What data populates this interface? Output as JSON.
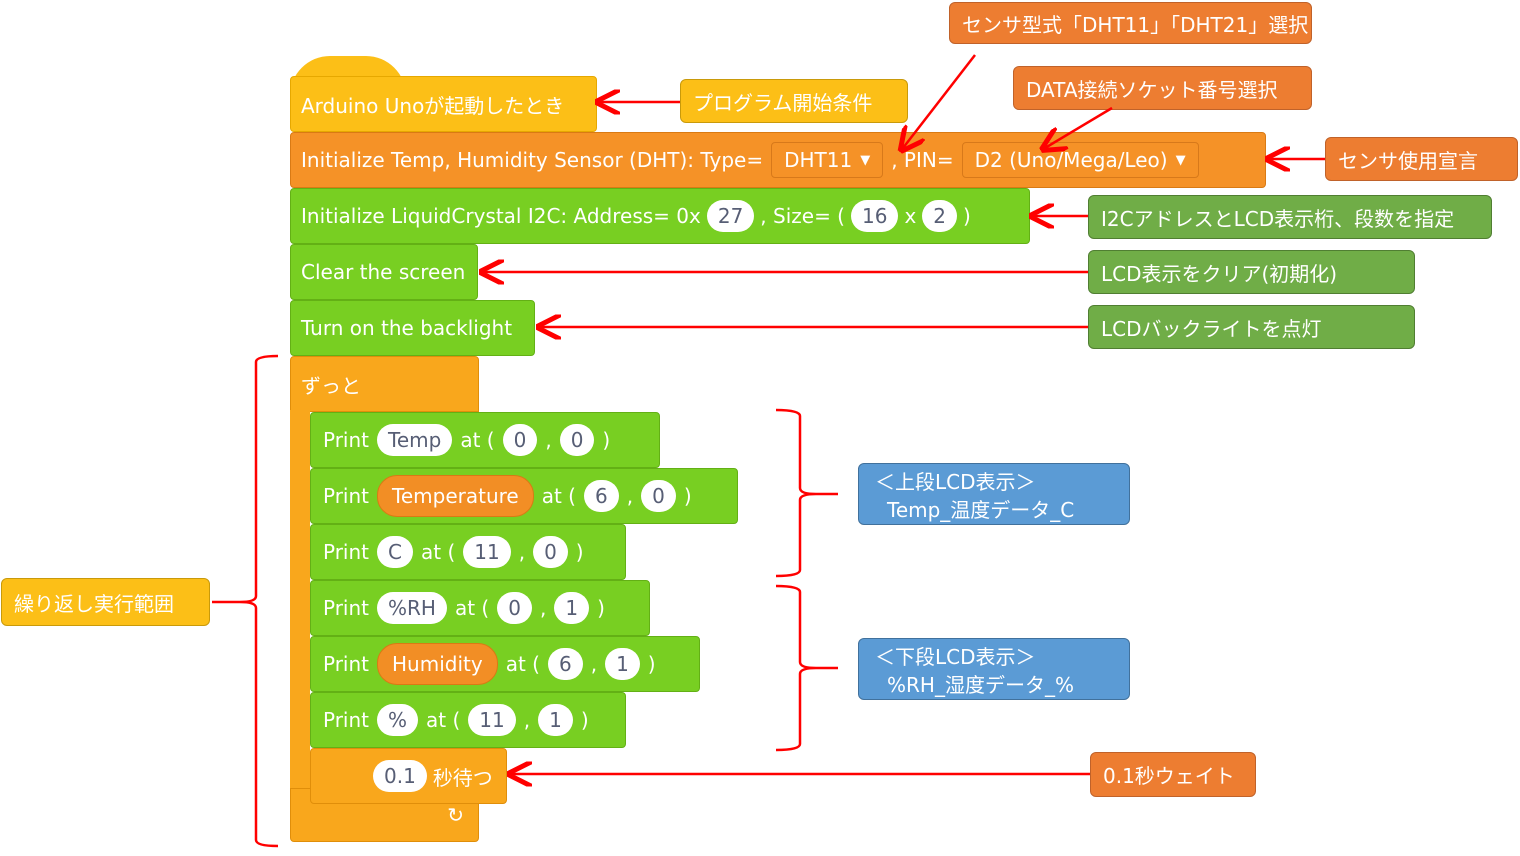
{
  "blocks": {
    "start": {
      "label": "Arduino Unoが起動したとき"
    },
    "dht_init": {
      "label": "Initialize Temp, Humidity Sensor (DHT): Type=",
      "type_value": "DHT11",
      "pin_label": ", PIN=",
      "pin_value": "D2 (Uno/Mega/Leo)",
      "dropdown_arrow": "▼"
    },
    "lcd_init": {
      "label": "Initialize LiquidCrystal I2C: Address= 0x",
      "address": "27",
      "size_label": ", Size= (",
      "cols": "16",
      "x": "x",
      "rows": "2",
      "close": ")"
    },
    "clear": {
      "label": "Clear the screen"
    },
    "backlight": {
      "label": "Turn on the backlight"
    },
    "forever": {
      "label": "ずっと",
      "repeat_icon": "↻"
    },
    "prints": [
      {
        "print": "Print",
        "text": "Temp",
        "is_var": false,
        "at": "at (",
        "col": "0",
        "comma": ",",
        "row": "0",
        "close": ")"
      },
      {
        "print": "Print",
        "text": "Temperature",
        "is_var": true,
        "at": "at (",
        "col": "6",
        "comma": ",",
        "row": "0",
        "close": ")"
      },
      {
        "print": "Print",
        "text": "C",
        "is_var": false,
        "at": "at (",
        "col": "11",
        "comma": ",",
        "row": "0",
        "close": ")"
      },
      {
        "print": "Print",
        "text": "%RH",
        "is_var": false,
        "at": "at (",
        "col": "0",
        "comma": ",",
        "row": "1",
        "close": ")"
      },
      {
        "print": "Print",
        "text": "Humidity",
        "is_var": true,
        "at": "at (",
        "col": "6",
        "comma": ",",
        "row": "1",
        "close": ")"
      },
      {
        "print": "Print",
        "text": "%",
        "is_var": false,
        "at": "at (",
        "col": "11",
        "comma": ",",
        "row": "1",
        "close": ")"
      }
    ],
    "wait": {
      "value": "0.1",
      "label": "秒待つ"
    }
  },
  "callouts": {
    "program_start": "プログラム開始条件",
    "sensor_type": "センサ型式「DHT11」「DHT21」選択",
    "data_socket": "DATA接続ソケット番号選択",
    "sensor_decl": "センサ使用宣言",
    "i2c": "I2CアドレスとLCD表示桁、段数を指定",
    "clear": "LCD表示をクリア(初期化)",
    "backlight": "LCDバックライトを点灯",
    "upper_line1": "＜上段LCD表示＞",
    "upper_line2": "Temp_温度データ_C",
    "lower_line1": "＜下段LCD表示＞",
    "lower_line2": "%RH_湿度データ_%",
    "loop_range": "繰り返し実行範囲",
    "wait": "0.1秒ウェイト"
  },
  "colors": {
    "hat": "#fcbf17",
    "orange": "#f59227",
    "green": "#78cf22",
    "loop": "#f9a71c",
    "arrow": "#ff0000",
    "callout_green": "#70ad47",
    "callout_blue": "#5b9bd5",
    "callout_orange": "#ed7d31"
  }
}
